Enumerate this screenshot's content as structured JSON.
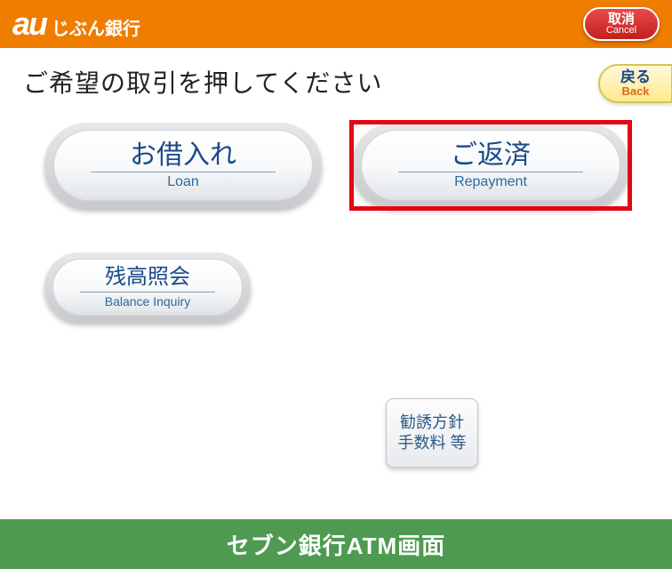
{
  "header": {
    "logo_prefix": "au",
    "logo_bank": "じぶん銀行",
    "cancel_jp": "取消",
    "cancel_en": "Cancel"
  },
  "instruction": "ご希望の取引を押してください",
  "back": {
    "jp": "戻る",
    "en": "Back"
  },
  "buttons": {
    "loan": {
      "jp": "お借入れ",
      "en": "Loan"
    },
    "repayment": {
      "jp": "ご返済",
      "en": "Repayment"
    },
    "balance": {
      "jp": "残高照会",
      "en": "Balance Inquiry"
    }
  },
  "info": {
    "line1": "勧誘方針",
    "line2": "手数料 等"
  },
  "footer": "セブン銀行ATM画面"
}
